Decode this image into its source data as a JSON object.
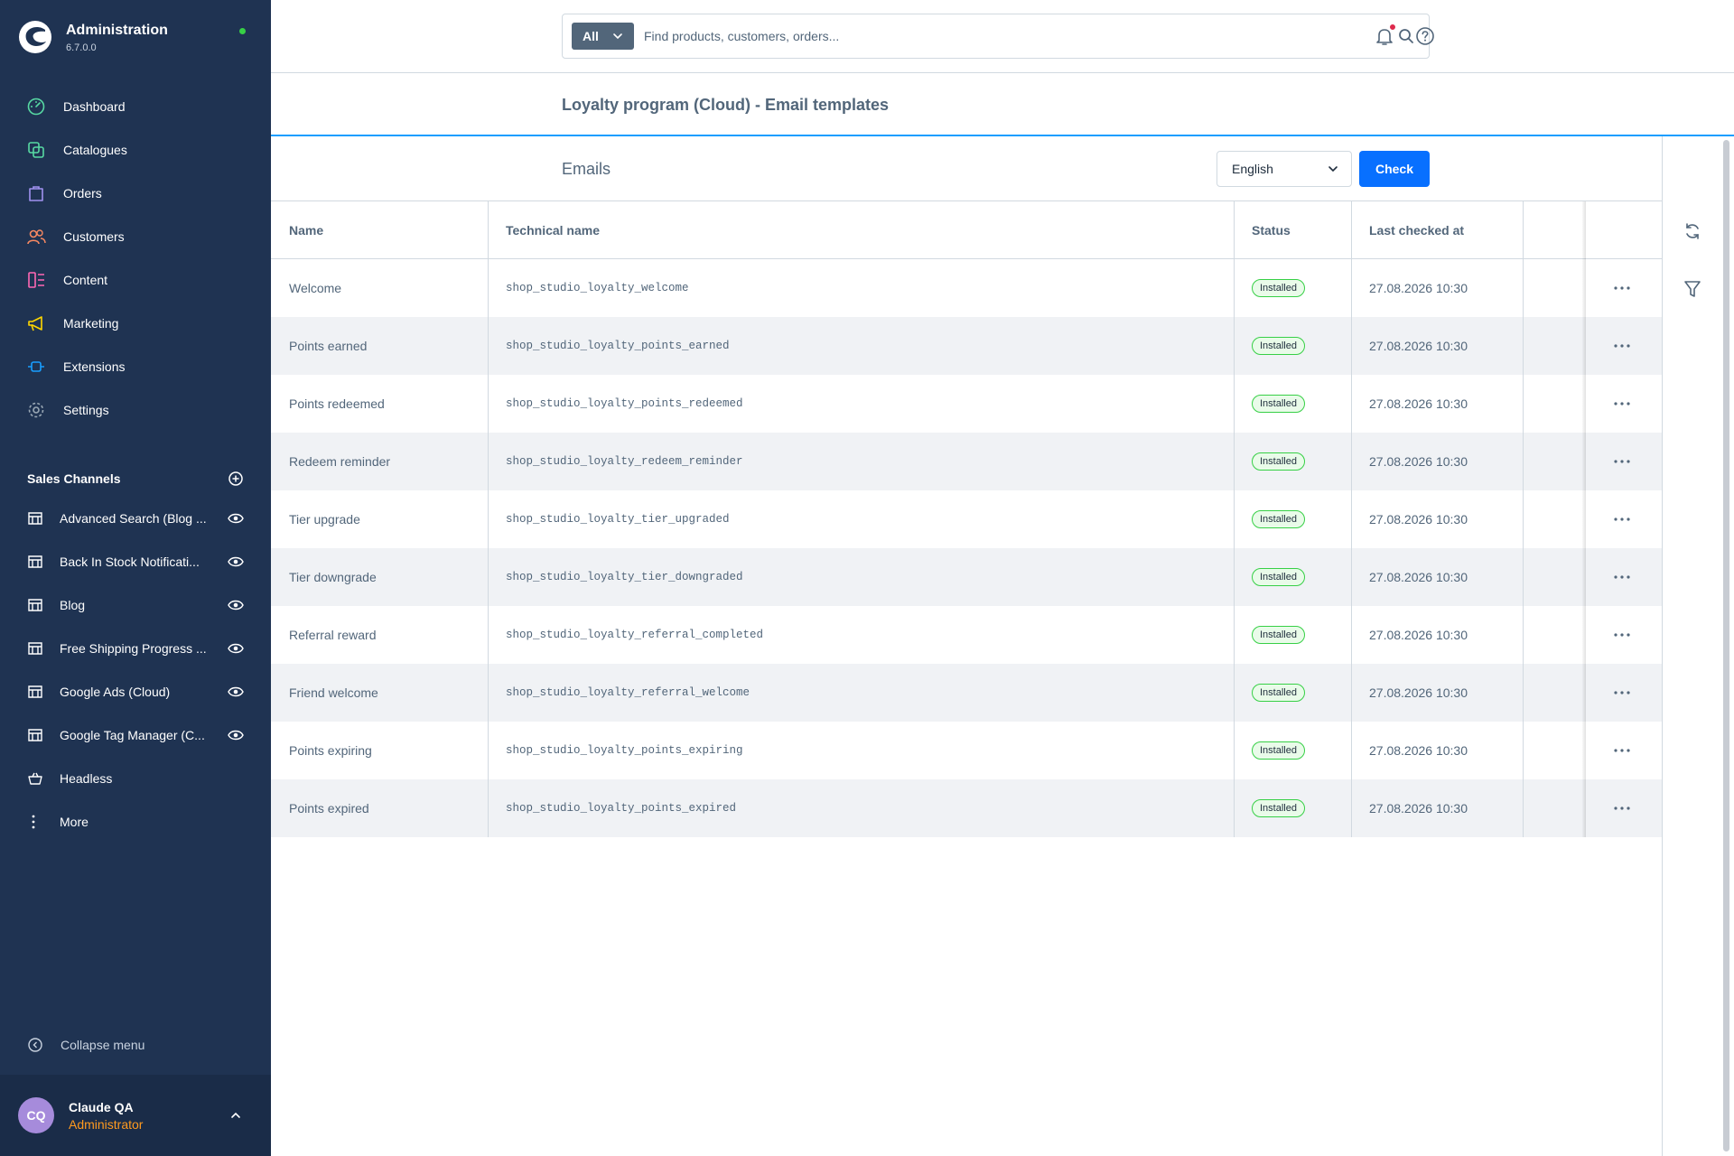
{
  "brand": {
    "title": "Administration",
    "version": "6.7.0.0",
    "status_color": "#37d046"
  },
  "nav": {
    "items": [
      {
        "label": "Dashboard",
        "icon": "dashboard-icon",
        "color": "#57d9a3"
      },
      {
        "label": "Catalogues",
        "icon": "catalogue-icon",
        "color": "#57d9a3"
      },
      {
        "label": "Orders",
        "icon": "orders-icon",
        "color": "#a092f0"
      },
      {
        "label": "Customers",
        "icon": "customers-icon",
        "color": "#f88962"
      },
      {
        "label": "Content",
        "icon": "content-icon",
        "color": "#ff68b4"
      },
      {
        "label": "Marketing",
        "icon": "marketing-icon",
        "color": "#ffd700"
      },
      {
        "label": "Extensions",
        "icon": "extensions-icon",
        "color": "#189eff"
      },
      {
        "label": "Settings",
        "icon": "settings-icon",
        "color": "#9aa8b5"
      }
    ]
  },
  "sales_channels": {
    "title": "Sales Channels",
    "items": [
      {
        "label": "Advanced Search (Blog ...",
        "visible": true
      },
      {
        "label": "Back In Stock Notificati...",
        "visible": true
      },
      {
        "label": "Blog",
        "visible": true
      },
      {
        "label": "Free Shipping Progress ...",
        "visible": true
      },
      {
        "label": "Google Ads (Cloud)",
        "visible": true
      },
      {
        "label": "Google Tag Manager (C...",
        "visible": true
      },
      {
        "label": "Headless",
        "visible": false
      },
      {
        "label": "More",
        "visible": false
      }
    ]
  },
  "collapse_label": "Collapse menu",
  "user": {
    "initials": "CQ",
    "name": "Claude QA",
    "role": "Administrator"
  },
  "search": {
    "type": "All",
    "placeholder": "Find products, customers, orders..."
  },
  "page": {
    "title": "Loyalty program (Cloud) - Email templates"
  },
  "card": {
    "title": "Emails",
    "language": "English",
    "check_label": "Check"
  },
  "table": {
    "columns": [
      "Name",
      "Technical name",
      "Status",
      "Last checked at"
    ],
    "rows": [
      {
        "name": "Welcome",
        "technical": "shop_studio_loyalty_welcome",
        "status": "Installed",
        "checked": "27.08.2026 10:30"
      },
      {
        "name": "Points earned",
        "technical": "shop_studio_loyalty_points_earned",
        "status": "Installed",
        "checked": "27.08.2026 10:30"
      },
      {
        "name": "Points redeemed",
        "technical": "shop_studio_loyalty_points_redeemed",
        "status": "Installed",
        "checked": "27.08.2026 10:30"
      },
      {
        "name": "Redeem reminder",
        "technical": "shop_studio_loyalty_redeem_reminder",
        "status": "Installed",
        "checked": "27.08.2026 10:30"
      },
      {
        "name": "Tier upgrade",
        "technical": "shop_studio_loyalty_tier_upgraded",
        "status": "Installed",
        "checked": "27.08.2026 10:30"
      },
      {
        "name": "Tier downgrade",
        "technical": "shop_studio_loyalty_tier_downgraded",
        "status": "Installed",
        "checked": "27.08.2026 10:30"
      },
      {
        "name": "Referral reward",
        "technical": "shop_studio_loyalty_referral_completed",
        "status": "Installed",
        "checked": "27.08.2026 10:30"
      },
      {
        "name": "Friend welcome",
        "technical": "shop_studio_loyalty_referral_welcome",
        "status": "Installed",
        "checked": "27.08.2026 10:30"
      },
      {
        "name": "Points expiring",
        "technical": "shop_studio_loyalty_points_expiring",
        "status": "Installed",
        "checked": "27.08.2026 10:30"
      },
      {
        "name": "Points expired",
        "technical": "shop_studio_loyalty_points_expired",
        "status": "Installed",
        "checked": "27.08.2026 10:30"
      }
    ]
  },
  "colors": {
    "sidebar": "#1f3352",
    "accent": "#189eff",
    "primary_button": "#0870ff",
    "status_installed": "#37d046",
    "notification": "#de294c",
    "role": "#ff9a1f"
  }
}
